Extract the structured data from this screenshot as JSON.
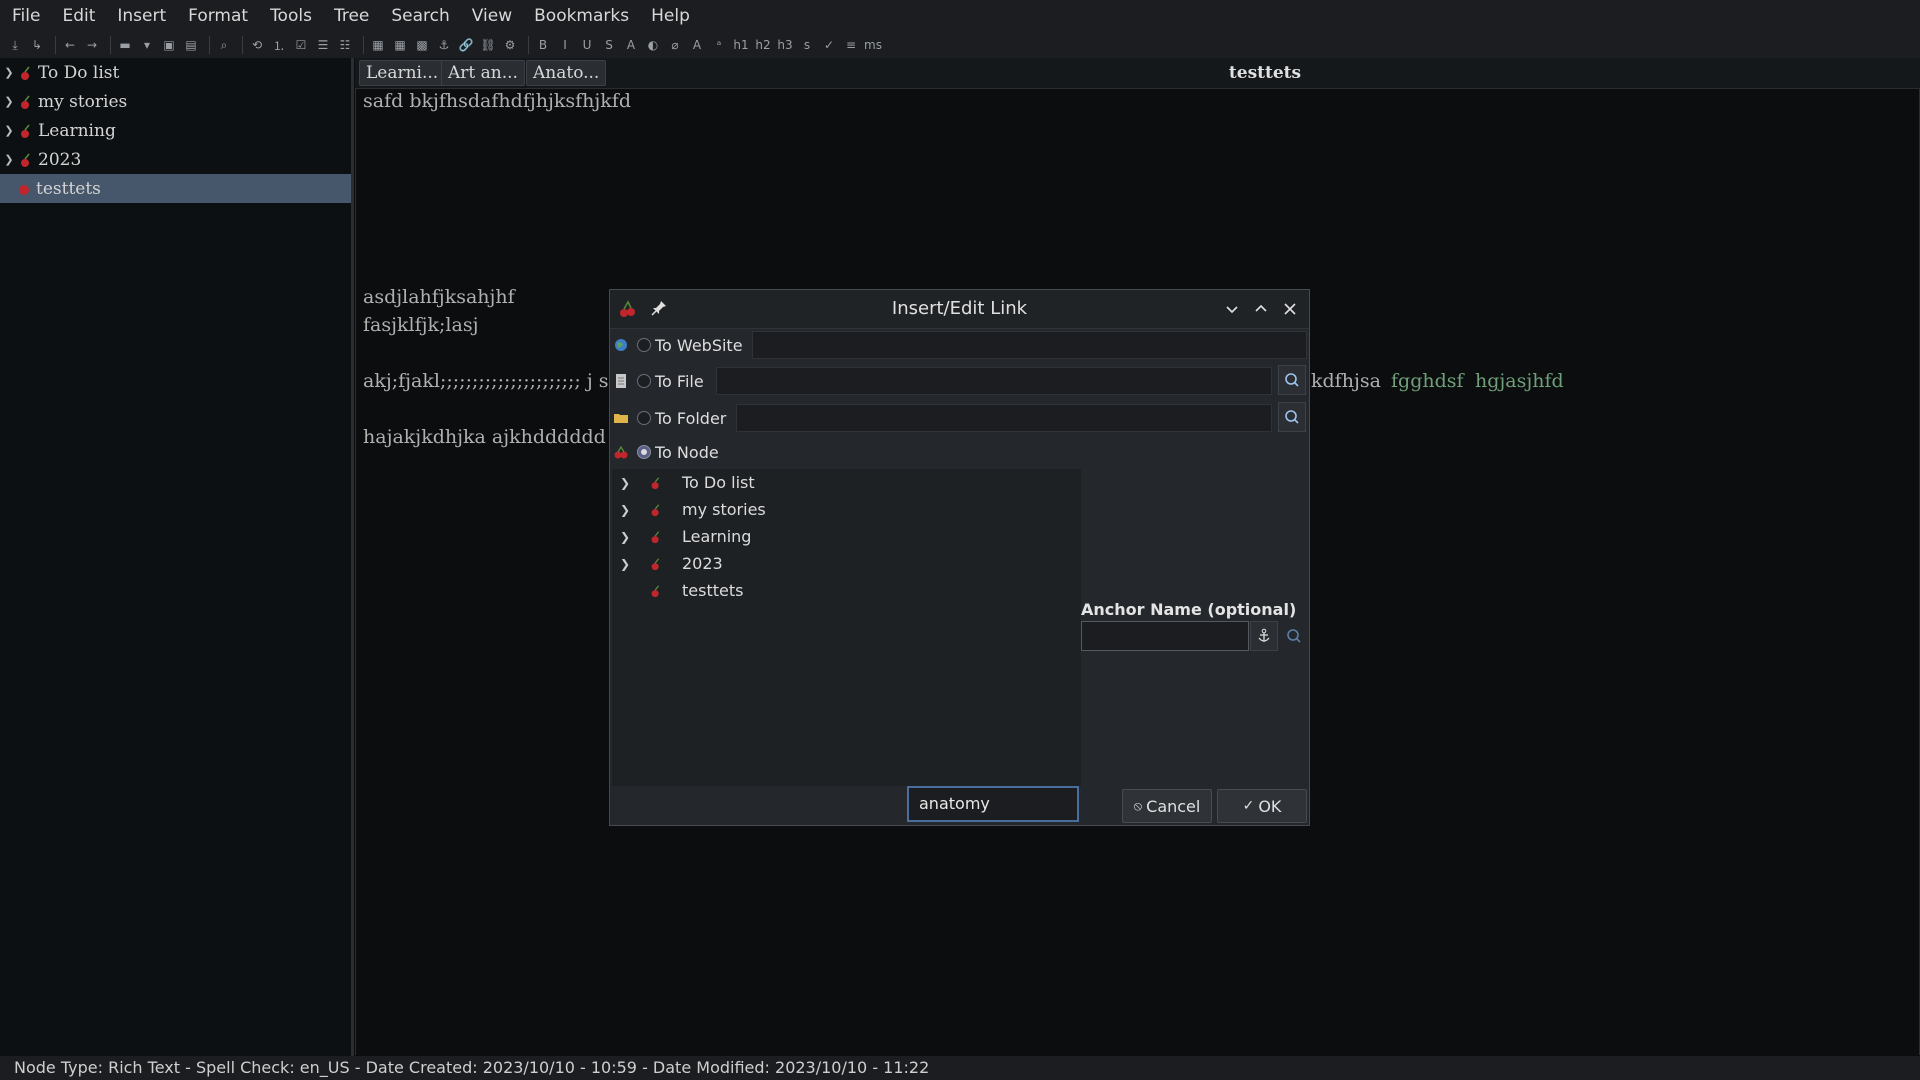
{
  "menubar": {
    "items": [
      "File",
      "Edit",
      "Insert",
      "Format",
      "Tools",
      "Tree",
      "Search",
      "View",
      "Bookmarks",
      "Help"
    ]
  },
  "sidebar": {
    "items": [
      {
        "label": "To Do list",
        "expandable": true
      },
      {
        "label": "my stories",
        "expandable": true
      },
      {
        "label": "Learning",
        "expandable": true
      },
      {
        "label": "2023",
        "expandable": true
      },
      {
        "label": "testtets",
        "expandable": false,
        "selected": true
      }
    ]
  },
  "tabs": [
    "Learni...",
    "Art an...",
    "Anato..."
  ],
  "node_title": "testtets",
  "editor": {
    "line1": "safd bkjfhsdafhdfjhjksfhjkfd",
    "line2": "asdjlahfjksahjhf",
    "line3": "fasjklfjk;lasj",
    "line4": "akj;fjakl;;;;;;;;;;;;;;;;;;;;;; j sf",
    "line4_right": "kdfhjsa",
    "link1": "fgghdsf",
    "link2": "hgjasjhfd",
    "line5": "hajakjkdhjka ajkhdddddd"
  },
  "status": {
    "text": "Node Type: Rich Text  -  Spell Check: en_US  -  Date Created: 2023/10/10 - 10:59  -  Date Modified: 2023/10/10 - 11:22"
  },
  "dialog": {
    "title": "Insert/Edit Link",
    "options": {
      "website": "To WebSite",
      "file": "To File",
      "folder": "To Folder",
      "node": "To Node"
    },
    "selected_option": "To Node",
    "node_tree": [
      {
        "label": "To Do list",
        "expandable": true
      },
      {
        "label": "my stories",
        "expandable": true
      },
      {
        "label": "Learning",
        "expandable": true
      },
      {
        "label": "2023",
        "expandable": true
      },
      {
        "label": "testtets",
        "expandable": false
      }
    ],
    "anchor_label": "Anchor Name (optional)",
    "filter_value": "anatomy",
    "cancel_label": "Cancel",
    "ok_label": "OK"
  },
  "colors": {
    "accent": "#4a6e9b",
    "selected_row": "#46576b",
    "link_text": "#6fa07a",
    "cherry": "#c0262c"
  }
}
